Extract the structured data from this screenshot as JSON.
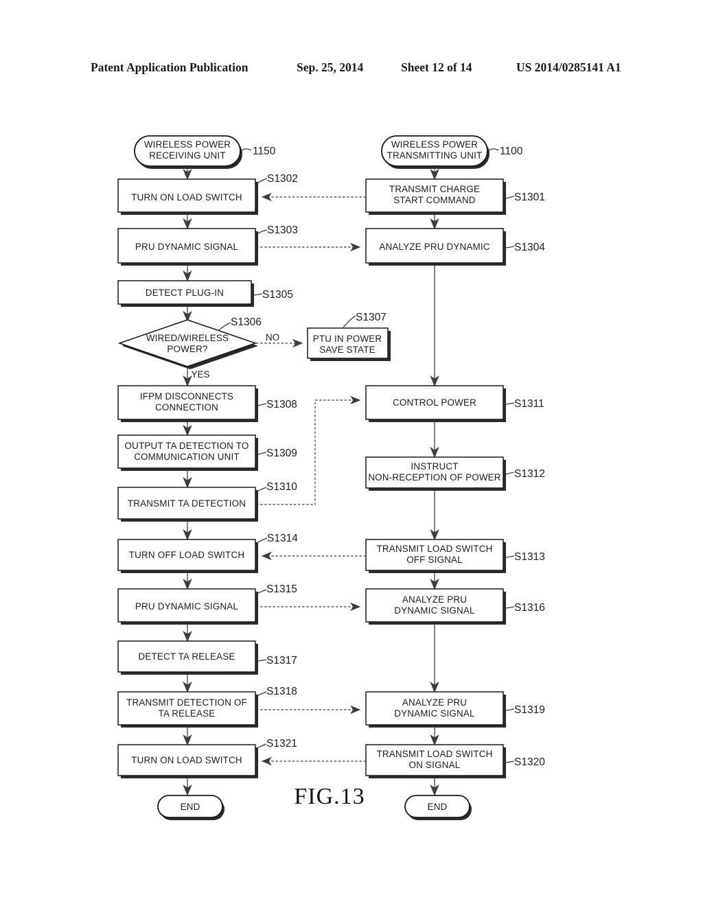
{
  "header": {
    "publication": "Patent Application Publication",
    "date": "Sep. 25, 2014",
    "sheet": "Sheet 12 of 14",
    "patent_number": "US 2014/0285141 A1"
  },
  "figure": {
    "caption": "FIG.13"
  },
  "flowchart": {
    "left_lane": {
      "start": {
        "label": "WIRELESS POWER\nRECEIVING UNIT",
        "line1": "WIRELESS POWER",
        "line2": "RECEIVING UNIT",
        "ref": "1150"
      },
      "end": {
        "label": "END"
      },
      "decision_yes": "YES",
      "decision_no": "NO",
      "steps": [
        {
          "id": "S1302",
          "line1": "TURN ON LOAD SWITCH",
          "line2": ""
        },
        {
          "id": "S1303",
          "line1": "PRU DYNAMIC SIGNAL",
          "line2": ""
        },
        {
          "id": "S1305",
          "line1": "DETECT PLUG-IN",
          "line2": ""
        },
        {
          "id": "S1306",
          "line1": "WIRED/WIRELESS",
          "line2": "POWER?",
          "shape": "diamond"
        },
        {
          "id": "S1308",
          "line1": "IFPM DISCONNECTS",
          "line2": "CONNECTION"
        },
        {
          "id": "S1309",
          "line1": "OUTPUT TA DETECTION TO",
          "line2": "COMMUNICATION UNIT"
        },
        {
          "id": "S1310",
          "line1": "TRANSMIT TA DETECTION",
          "line2": ""
        },
        {
          "id": "S1314",
          "line1": "TURN OFF LOAD SWITCH",
          "line2": ""
        },
        {
          "id": "S1315",
          "line1": "PRU DYNAMIC SIGNAL",
          "line2": ""
        },
        {
          "id": "S1317",
          "line1": "DETECT TA RELEASE",
          "line2": ""
        },
        {
          "id": "S1318",
          "line1": "TRANSMIT DETECTION OF",
          "line2": "TA RELEASE"
        },
        {
          "id": "S1321",
          "line1": "TURN ON LOAD SWITCH",
          "line2": ""
        }
      ]
    },
    "right_lane": {
      "start": {
        "label": "WIRELESS POWER\nTRANSMITTING UNIT",
        "line1": "WIRELESS POWER",
        "line2": "TRANSMITTING UNIT",
        "ref": "1100"
      },
      "end": {
        "label": "END"
      },
      "steps": [
        {
          "id": "S1301",
          "line1": "TRANSMIT CHARGE",
          "line2": "START COMMAND"
        },
        {
          "id": "S1304",
          "line1": "ANALYZE PRU DYNAMIC",
          "line2": ""
        },
        {
          "id": "S1311",
          "line1": "CONTROL POWER",
          "line2": ""
        },
        {
          "id": "S1312",
          "line1": "INSTRUCT",
          "line2": "NON-RECEPTION OF POWER"
        },
        {
          "id": "S1313",
          "line1": "TRANSMIT LOAD SWITCH",
          "line2": "OFF SIGNAL"
        },
        {
          "id": "S1316",
          "line1": "ANALYZE PRU",
          "line2": "DYNAMIC SIGNAL"
        },
        {
          "id": "S1319",
          "line1": "ANALYZE PRU",
          "line2": "DYNAMIC SIGNAL"
        },
        {
          "id": "S1320",
          "line1": "TRANSMIT LOAD SWITCH",
          "line2": "ON SIGNAL"
        }
      ]
    },
    "branch_box": {
      "id": "S1307",
      "line1": "PTU IN POWER",
      "line2": "SAVE STATE"
    }
  }
}
